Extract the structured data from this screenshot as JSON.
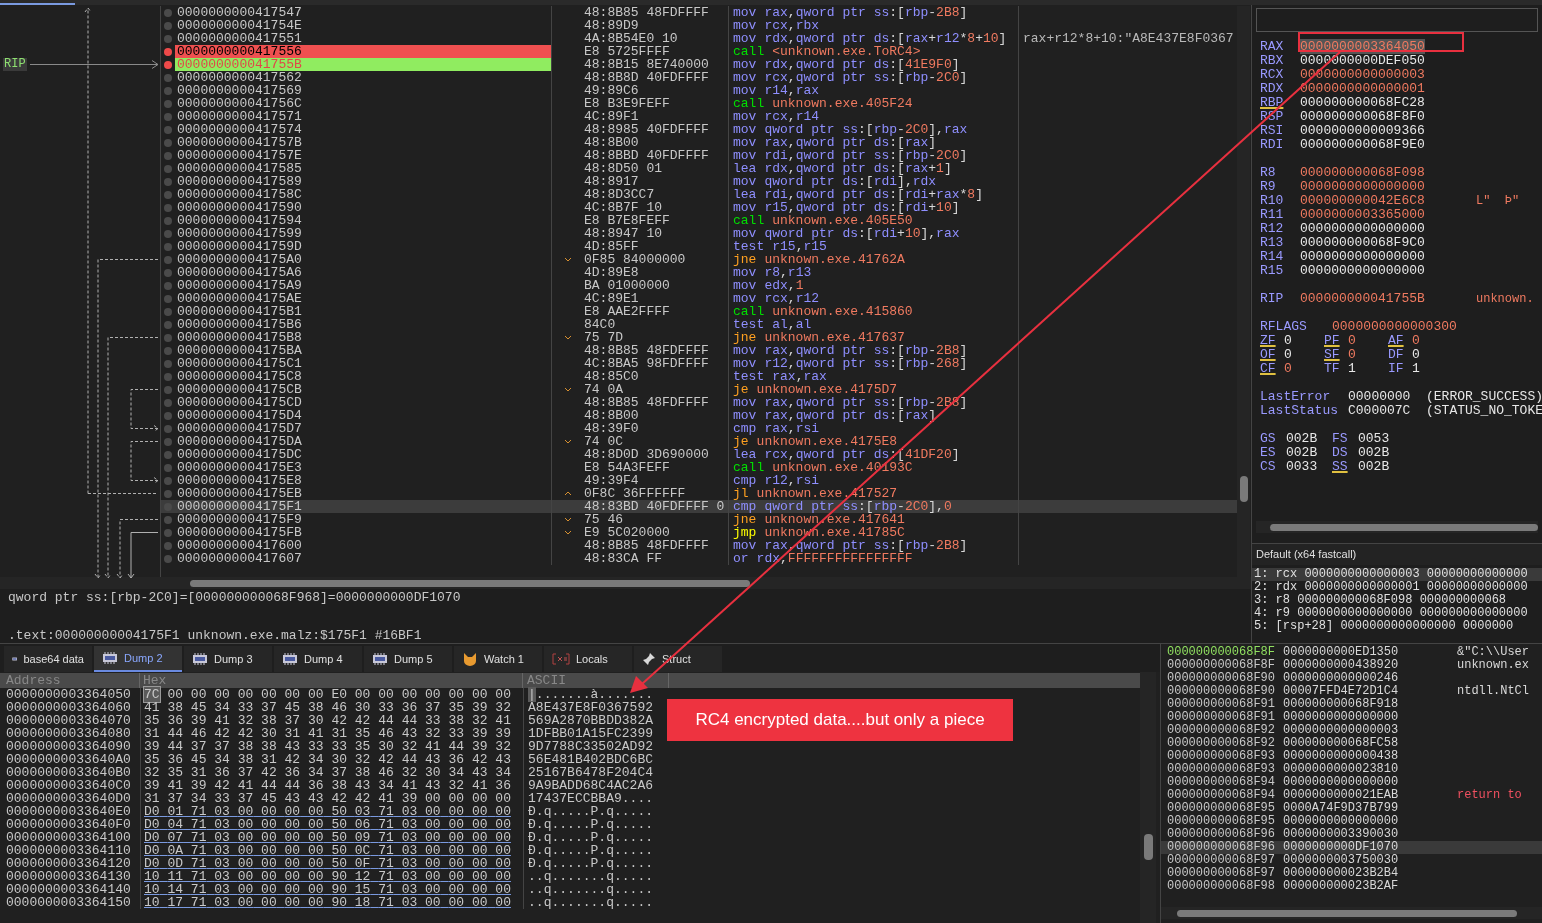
{
  "disassembly": {
    "rip_label": "RIP",
    "rows": [
      {
        "address": "0000000000417547",
        "bytes": "48:8B85 48FDFFFF",
        "mnemonic": "mov",
        "operands": "rax,qword ptr ss:[rbp-2B8]",
        "kind": "plain",
        "breakpoint": false,
        "current": false,
        "selected": false
      },
      {
        "address": "000000000041754E",
        "bytes": "48:89D9",
        "mnemonic": "mov",
        "operands": "rcx,rbx",
        "kind": "plain",
        "breakpoint": false,
        "current": false,
        "selected": false
      },
      {
        "address": "0000000000417551",
        "bytes": "4A:8B54E0 10",
        "mnemonic": "mov",
        "operands": "rdx,qword ptr ds:[rax+r12*8+10]",
        "kind": "plain",
        "breakpoint": false,
        "current": false,
        "selected": false,
        "comment": "rax+r12*8+10:\"A8E437E8F0367"
      },
      {
        "address": "0000000000417556",
        "bytes": "E8 5725FFFF",
        "mnemonic": "call",
        "operands": "<unknown.exe.ToRC4>",
        "kind": "call",
        "breakpoint": true,
        "current": false,
        "selected": false
      },
      {
        "address": "000000000041755B",
        "bytes": "48:8B15 8E740000",
        "mnemonic": "mov",
        "operands": "rdx,qword ptr ds:[41E9F0]",
        "kind": "plain",
        "breakpoint": true,
        "current": true,
        "selected": false
      },
      {
        "address": "0000000000417562",
        "bytes": "48:8B8D 40FDFFFF",
        "mnemonic": "mov",
        "operands": "rcx,qword ptr ss:[rbp-2C0]",
        "kind": "plain",
        "breakpoint": false,
        "current": false,
        "selected": false
      },
      {
        "address": "0000000000417569",
        "bytes": "49:89C6",
        "mnemonic": "mov",
        "operands": "r14,rax",
        "kind": "plain",
        "breakpoint": false,
        "current": false,
        "selected": false
      },
      {
        "address": "000000000041756C",
        "bytes": "E8 B3E9FEFF",
        "mnemonic": "call",
        "operands": "unknown.exe.405F24",
        "kind": "call",
        "breakpoint": false,
        "current": false,
        "selected": false
      },
      {
        "address": "0000000000417571",
        "bytes": "4C:89F1",
        "mnemonic": "mov",
        "operands": "rcx,r14",
        "kind": "plain",
        "breakpoint": false,
        "current": false,
        "selected": false
      },
      {
        "address": "0000000000417574",
        "bytes": "48:8985 40FDFFFF",
        "mnemonic": "mov",
        "operands": "qword ptr ss:[rbp-2C0],rax",
        "kind": "plain",
        "breakpoint": false,
        "current": false,
        "selected": false
      },
      {
        "address": "000000000041757B",
        "bytes": "48:8B00",
        "mnemonic": "mov",
        "operands": "rax,qword ptr ds:[rax]",
        "kind": "plain",
        "breakpoint": false,
        "current": false,
        "selected": false
      },
      {
        "address": "000000000041757E",
        "bytes": "48:8BBD 40FDFFFF",
        "mnemonic": "mov",
        "operands": "rdi,qword ptr ss:[rbp-2C0]",
        "kind": "plain",
        "breakpoint": false,
        "current": false,
        "selected": false
      },
      {
        "address": "0000000000417585",
        "bytes": "48:8D50 01",
        "mnemonic": "lea",
        "operands": "rdx,qword ptr ds:[rax+1]",
        "kind": "plain",
        "breakpoint": false,
        "current": false,
        "selected": false
      },
      {
        "address": "0000000000417589",
        "bytes": "48:8917",
        "mnemonic": "mov",
        "operands": "qword ptr ds:[rdi],rdx",
        "kind": "plain",
        "breakpoint": false,
        "current": false,
        "selected": false
      },
      {
        "address": "000000000041758C",
        "bytes": "48:8D3CC7",
        "mnemonic": "lea",
        "operands": "rdi,qword ptr ds:[rdi+rax*8]",
        "kind": "plain",
        "breakpoint": false,
        "current": false,
        "selected": false
      },
      {
        "address": "0000000000417590",
        "bytes": "4C:8B7F 10",
        "mnemonic": "mov",
        "operands": "r15,qword ptr ds:[rdi+10]",
        "kind": "plain",
        "breakpoint": false,
        "current": false,
        "selected": false
      },
      {
        "address": "0000000000417594",
        "bytes": "E8 B7E8FEFF",
        "mnemonic": "call",
        "operands": "unknown.exe.405E50",
        "kind": "call",
        "breakpoint": false,
        "current": false,
        "selected": false
      },
      {
        "address": "0000000000417599",
        "bytes": "48:8947 10",
        "mnemonic": "mov",
        "operands": "qword ptr ds:[rdi+10],rax",
        "kind": "plain",
        "breakpoint": false,
        "current": false,
        "selected": false
      },
      {
        "address": "000000000041759D",
        "bytes": "4D:85FF",
        "mnemonic": "test",
        "operands": "r15,r15",
        "kind": "plain",
        "breakpoint": false,
        "current": false,
        "selected": false
      },
      {
        "address": "00000000004175A0",
        "bytes": "0F85 84000000",
        "mnemonic": "jne",
        "operands": "unknown.exe.41762A",
        "kind": "branch",
        "breakpoint": false,
        "current": false,
        "selected": false
      },
      {
        "address": "00000000004175A6",
        "bytes": "4D:89E8",
        "mnemonic": "mov",
        "operands": "r8,r13",
        "kind": "plain",
        "breakpoint": false,
        "current": false,
        "selected": false
      },
      {
        "address": "00000000004175A9",
        "bytes": "BA 01000000",
        "mnemonic": "mov",
        "operands": "edx,1",
        "kind": "plain",
        "breakpoint": false,
        "current": false,
        "selected": false
      },
      {
        "address": "00000000004175AE",
        "bytes": "4C:89E1",
        "mnemonic": "mov",
        "operands": "rcx,r12",
        "kind": "plain",
        "breakpoint": false,
        "current": false,
        "selected": false
      },
      {
        "address": "00000000004175B1",
        "bytes": "E8 AAE2FFFF",
        "mnemonic": "call",
        "operands": "unknown.exe.415860",
        "kind": "call",
        "breakpoint": false,
        "current": false,
        "selected": false
      },
      {
        "address": "00000000004175B6",
        "bytes": "84C0",
        "mnemonic": "test",
        "operands": "al,al",
        "kind": "plain",
        "breakpoint": false,
        "current": false,
        "selected": false
      },
      {
        "address": "00000000004175B8",
        "bytes": "75 7D",
        "mnemonic": "jne",
        "operands": "unknown.exe.417637",
        "kind": "branch",
        "breakpoint": false,
        "current": false,
        "selected": false
      },
      {
        "address": "00000000004175BA",
        "bytes": "48:8B85 48FDFFFF",
        "mnemonic": "mov",
        "operands": "rax,qword ptr ss:[rbp-2B8]",
        "kind": "plain",
        "breakpoint": false,
        "current": false,
        "selected": false
      },
      {
        "address": "00000000004175C1",
        "bytes": "4C:8BA5 98FDFFFF",
        "mnemonic": "mov",
        "operands": "r12,qword ptr ss:[rbp-268]",
        "kind": "plain",
        "breakpoint": false,
        "current": false,
        "selected": false
      },
      {
        "address": "00000000004175C8",
        "bytes": "48:85C0",
        "mnemonic": "test",
        "operands": "rax,rax",
        "kind": "plain",
        "breakpoint": false,
        "current": false,
        "selected": false
      },
      {
        "address": "00000000004175CB",
        "bytes": "74 0A",
        "mnemonic": "je",
        "operands": "unknown.exe.4175D7",
        "kind": "branch",
        "breakpoint": false,
        "current": false,
        "selected": false
      },
      {
        "address": "00000000004175CD",
        "bytes": "48:8B85 48FDFFFF",
        "mnemonic": "mov",
        "operands": "rax,qword ptr ss:[rbp-2B8]",
        "kind": "plain",
        "breakpoint": false,
        "current": false,
        "selected": false
      },
      {
        "address": "00000000004175D4",
        "bytes": "48:8B00",
        "mnemonic": "mov",
        "operands": "rax,qword ptr ds:[rax]",
        "kind": "plain",
        "breakpoint": false,
        "current": false,
        "selected": false
      },
      {
        "address": "00000000004175D7",
        "bytes": "48:39F0",
        "mnemonic": "cmp",
        "operands": "rax,rsi",
        "kind": "plain",
        "breakpoint": false,
        "current": false,
        "selected": false
      },
      {
        "address": "00000000004175DA",
        "bytes": "74 0C",
        "mnemonic": "je",
        "operands": "unknown.exe.4175E8",
        "kind": "branch",
        "breakpoint": false,
        "current": false,
        "selected": false
      },
      {
        "address": "00000000004175DC",
        "bytes": "48:8D0D 3D690000",
        "mnemonic": "lea",
        "operands": "rcx,qword ptr ds:[41DF20]",
        "kind": "plain",
        "breakpoint": false,
        "current": false,
        "selected": false
      },
      {
        "address": "00000000004175E3",
        "bytes": "E8 54A3FEFF",
        "mnemonic": "call",
        "operands": "unknown.exe.40193C",
        "kind": "call",
        "breakpoint": false,
        "current": false,
        "selected": false
      },
      {
        "address": "00000000004175E8",
        "bytes": "49:39F4",
        "mnemonic": "cmp",
        "operands": "r12,rsi",
        "kind": "plain",
        "breakpoint": false,
        "current": false,
        "selected": false
      },
      {
        "address": "00000000004175EB",
        "bytes": "0F8C 36FFFFFF",
        "mnemonic": "jl",
        "operands": "unknown.exe.417527",
        "kind": "branch_up",
        "breakpoint": false,
        "current": false,
        "selected": false
      },
      {
        "address": "00000000004175F1",
        "bytes": "48:83BD 40FDFFFF 0",
        "mnemonic": "cmp",
        "operands": "qword ptr ss:[rbp-2C0],0",
        "kind": "plain",
        "breakpoint": false,
        "current": false,
        "selected": true
      },
      {
        "address": "00000000004175F9",
        "bytes": "75 46",
        "mnemonic": "jne",
        "operands": "unknown.exe.417641",
        "kind": "branch",
        "breakpoint": false,
        "current": false,
        "selected": false
      },
      {
        "address": "00000000004175FB",
        "bytes": "E9 5C020000",
        "mnemonic": "jmp",
        "operands": "unknown.exe.41785C",
        "kind": "jump",
        "breakpoint": false,
        "current": false,
        "selected": false
      },
      {
        "address": "0000000000417600",
        "bytes": "48:8B85 48FDFFFF",
        "mnemonic": "mov",
        "operands": "rax,qword ptr ss:[rbp-2B8]",
        "kind": "plain",
        "breakpoint": false,
        "current": false,
        "selected": false
      },
      {
        "address": "0000000000417607",
        "bytes": "48:83CA FF",
        "mnemonic": "or",
        "operands": "rdx,FFFFFFFFFFFFFFFF",
        "kind": "plain",
        "breakpoint": false,
        "current": false,
        "selected": false
      }
    ]
  },
  "info": {
    "line_1": "qword ptr ss:[rbp-2C0]=[000000000068F968]=0000000000DF1070",
    "line_2": ".text:00000000004175F1 unknown.exe.malz:$175F1 #16BF1"
  },
  "registers": {
    "groups": [
      [
        {
          "name": "RAX",
          "value": "0000000003364050",
          "changed": true,
          "underlined": false,
          "selected": true
        },
        {
          "name": "RBX",
          "value": "0000000000DEF050",
          "changed": false,
          "underlined": false,
          "selected": false
        },
        {
          "name": "RCX",
          "value": "0000000000000003",
          "changed": true,
          "underlined": false,
          "selected": false
        },
        {
          "name": "RDX",
          "value": "0000000000000001",
          "changed": true,
          "underlined": false,
          "selected": false
        },
        {
          "name": "RBP",
          "value": "000000000068FC28",
          "changed": false,
          "underlined": true,
          "selected": false
        },
        {
          "name": "RSP",
          "value": "000000000068F8F0",
          "changed": false,
          "underlined": false,
          "selected": false
        },
        {
          "name": "RSI",
          "value": "0000000000009366",
          "changed": false,
          "underlined": false,
          "selected": false
        },
        {
          "name": "RDI",
          "value": "000000000068F9E0",
          "changed": false,
          "underlined": false,
          "selected": false
        }
      ],
      [
        {
          "name": "R8",
          "value": "000000000068F098",
          "changed": true,
          "underlined": false,
          "selected": false
        },
        {
          "name": "R9",
          "value": "0000000000000000",
          "changed": true,
          "underlined": false,
          "selected": false
        },
        {
          "name": "R10",
          "value": "000000000042E6C8",
          "changed": true,
          "underlined": false,
          "selected": false,
          "comment": "L\"  Þ\""
        },
        {
          "name": "R11",
          "value": "0000000003365000",
          "changed": true,
          "underlined": false,
          "selected": false
        },
        {
          "name": "R12",
          "value": "0000000000000000",
          "changed": false,
          "underlined": false,
          "selected": false
        },
        {
          "name": "R13",
          "value": "000000000068F9C0",
          "changed": false,
          "underlined": false,
          "selected": false
        },
        {
          "name": "R14",
          "value": "0000000000000000",
          "changed": false,
          "underlined": false,
          "selected": false
        },
        {
          "name": "R15",
          "value": "0000000000000000",
          "changed": false,
          "underlined": false,
          "selected": false
        }
      ],
      [
        {
          "name": "RIP",
          "value": "000000000041755B",
          "changed": true,
          "underlined": false,
          "selected": false,
          "comment": "unknown."
        }
      ]
    ],
    "rflags": {
      "name": "RFLAGS",
      "value": "0000000000000300",
      "changed": true
    },
    "flags": [
      [
        {
          "name": "ZF",
          "value": "0",
          "changed": false,
          "underlined": true
        },
        {
          "name": "PF",
          "value": "0",
          "changed": true,
          "underlined": true
        },
        {
          "name": "AF",
          "value": "0",
          "changed": true,
          "underlined": true
        }
      ],
      [
        {
          "name": "OF",
          "value": "0",
          "changed": false,
          "underlined": true
        },
        {
          "name": "SF",
          "value": "0",
          "changed": true,
          "underlined": true
        },
        {
          "name": "DF",
          "value": "0",
          "changed": false,
          "underlined": false
        }
      ],
      [
        {
          "name": "CF",
          "value": "0",
          "changed": true,
          "underlined": true
        },
        {
          "name": "TF",
          "value": "1",
          "changed": false,
          "underlined": false
        },
        {
          "name": "IF",
          "value": "1",
          "changed": false,
          "underlined": false
        }
      ]
    ],
    "last": [
      {
        "name": "LastError",
        "value": "00000000",
        "comment": "(ERROR_SUCCESS)"
      },
      {
        "name": "LastStatus",
        "value": "C000007C",
        "comment": "(STATUS_NO_TOKE"
      }
    ],
    "segments": [
      [
        {
          "name": "GS",
          "value": "002B",
          "underlined": false
        },
        {
          "name": "FS",
          "value": "0053",
          "underlined": false
        }
      ],
      [
        {
          "name": "ES",
          "value": "002B",
          "underlined": false
        },
        {
          "name": "DS",
          "value": "002B",
          "underlined": false
        }
      ],
      [
        {
          "name": "CS",
          "value": "0033",
          "underlined": false
        },
        {
          "name": "SS",
          "value": "002B",
          "underlined": true
        }
      ]
    ]
  },
  "call_convention": {
    "title": "Default (x64 fastcall)",
    "args": [
      {
        "text": "1: rcx 0000000000000003 00000000000000",
        "selected": true
      },
      {
        "text": "2: rdx 0000000000000001 00000000000000",
        "selected": false
      },
      {
        "text": "3: r8 000000000068F098 000000000068",
        "selected": false
      },
      {
        "text": "4: r9 0000000000000000 000000000000000",
        "selected": false
      },
      {
        "text": "5: [rsp+28] 0000000000000000 0000000",
        "selected": false
      }
    ]
  },
  "tabs": [
    {
      "label": "base64 data",
      "kind": "memory",
      "selected": false
    },
    {
      "label": "Dump 2",
      "kind": "memory",
      "selected": true
    },
    {
      "label": "Dump 3",
      "kind": "memory",
      "selected": false
    },
    {
      "label": "Dump 4",
      "kind": "memory",
      "selected": false
    },
    {
      "label": "Dump 5",
      "kind": "memory",
      "selected": false
    },
    {
      "label": "Watch 1",
      "kind": "watch",
      "selected": false
    },
    {
      "label": "Locals",
      "kind": "locals",
      "selected": false
    },
    {
      "label": "Struct",
      "kind": "struct",
      "selected": false
    }
  ],
  "dump": {
    "columns": [
      "Address",
      "Hex",
      "ASCII"
    ],
    "rows": [
      {
        "address": "0000000003364050",
        "hex": "7C 00 00 00 00 00 00 00 E0 00 00 00 00 00 00 00",
        "ascii": "|.......à.......",
        "pointer": false,
        "cursor": true
      },
      {
        "address": "0000000003364060",
        "hex": "41 38 45 34 33 37 45 38 46 30 33 36 37 35 39 32",
        "ascii": "A8E437E8F0367592",
        "pointer": false,
        "cursor": false
      },
      {
        "address": "0000000003364070",
        "hex": "35 36 39 41 32 38 37 30 42 42 44 44 33 38 32 41",
        "ascii": "569A2870BBDD382A",
        "pointer": false,
        "cursor": false
      },
      {
        "address": "0000000003364080",
        "hex": "31 44 46 42 42 30 31 41 31 35 46 43 32 33 39 39",
        "ascii": "1DFBB01A15FC2399",
        "pointer": false,
        "cursor": false
      },
      {
        "address": "0000000003364090",
        "hex": "39 44 37 37 38 38 43 33 33 35 30 32 41 44 39 32",
        "ascii": "9D7788C33502AD92",
        "pointer": false,
        "cursor": false
      },
      {
        "address": "00000000033640A0",
        "hex": "35 36 45 34 38 31 42 34 30 32 42 44 43 36 42 43",
        "ascii": "56E481B402BDC6BC",
        "pointer": false,
        "cursor": false
      },
      {
        "address": "00000000033640B0",
        "hex": "32 35 31 36 37 42 36 34 37 38 46 32 30 34 43 34",
        "ascii": "25167B6478F204C4",
        "pointer": false,
        "cursor": false
      },
      {
        "address": "00000000033640C0",
        "hex": "39 41 39 42 41 44 44 36 38 43 34 41 43 32 41 36",
        "ascii": "9A9BADD68C4AC2A6",
        "pointer": false,
        "cursor": false
      },
      {
        "address": "00000000033640D0",
        "hex": "31 37 34 33 37 45 43 43 42 42 41 39 00 00 00 00",
        "ascii": "17437ECCBBA9....",
        "pointer": false,
        "cursor": false
      },
      {
        "address": "00000000033640E0",
        "hex": "D0 01 71 03 00 00 00 00 50 03 71 03 00 00 00 00",
        "ascii": "Ð.q.....P.q.....",
        "pointer": true,
        "cursor": false
      },
      {
        "address": "00000000033640F0",
        "hex": "D0 04 71 03 00 00 00 00 50 06 71 03 00 00 00 00",
        "ascii": "Ð.q.....P.q.....",
        "pointer": true,
        "cursor": false
      },
      {
        "address": "0000000003364100",
        "hex": "D0 07 71 03 00 00 00 00 50 09 71 03 00 00 00 00",
        "ascii": "Ð.q.....P.q.....",
        "pointer": true,
        "cursor": false
      },
      {
        "address": "0000000003364110",
        "hex": "D0 0A 71 03 00 00 00 00 50 0C 71 03 00 00 00 00",
        "ascii": "Ð.q.....P.q.....",
        "pointer": true,
        "cursor": false
      },
      {
        "address": "0000000003364120",
        "hex": "D0 0D 71 03 00 00 00 00 50 0F 71 03 00 00 00 00",
        "ascii": "Ð.q.....P.q.....",
        "pointer": true,
        "cursor": false
      },
      {
        "address": "0000000003364130",
        "hex": "10 11 71 03 00 00 00 00 90 12 71 03 00 00 00 00",
        "ascii": "..q.......q.....",
        "pointer": true,
        "cursor": false
      },
      {
        "address": "0000000003364140",
        "hex": "10 14 71 03 00 00 00 00 90 15 71 03 00 00 00 00",
        "ascii": "..q.......q.....",
        "pointer": true,
        "cursor": false
      },
      {
        "address": "0000000003364150",
        "hex": "10 17 71 03 00 00 00 00 90 18 71 03 00 00 00 00",
        "ascii": "..q.......q.....",
        "pointer": true,
        "cursor": false
      }
    ]
  },
  "stack": {
    "rows": [
      {
        "address": "000000000068F8F",
        "value": "0000000000ED1350",
        "comment": "&\"C:\\\\User",
        "return_address": false,
        "rsp": true,
        "selected": false
      },
      {
        "address": "000000000068F8F",
        "value": "0000000000438920",
        "comment": "unknown.ex",
        "return_address": false,
        "rsp": false,
        "selected": false
      },
      {
        "address": "000000000068F90",
        "value": "0000000000000246",
        "rsp": false,
        "selected": false
      },
      {
        "address": "000000000068F90",
        "value": "00007FFD4E72D1C4",
        "comment": "ntdll.NtCl",
        "return_address": false,
        "rsp": false,
        "selected": false
      },
      {
        "address": "000000000068F91",
        "value": "000000000068F918",
        "rsp": false,
        "selected": false
      },
      {
        "address": "000000000068F91",
        "value": "0000000000000000",
        "rsp": false,
        "selected": false
      },
      {
        "address": "000000000068F92",
        "value": "0000000000000003",
        "rsp": false,
        "selected": false
      },
      {
        "address": "000000000068F92",
        "value": "000000000068FC58",
        "rsp": false,
        "selected": false
      },
      {
        "address": "000000000068F93",
        "value": "0000000000000438",
        "rsp": false,
        "selected": false
      },
      {
        "address": "000000000068F93",
        "value": "0000000000023810",
        "rsp": false,
        "selected": false
      },
      {
        "address": "000000000068F94",
        "value": "0000000000000000",
        "rsp": false,
        "selected": false
      },
      {
        "address": "000000000068F94",
        "value": "0000000000021EAB",
        "comment": "return to",
        "return_address": true,
        "rsp": false,
        "selected": false
      },
      {
        "address": "000000000068F95",
        "value": "0000A74F9D37B799",
        "rsp": false,
        "selected": false
      },
      {
        "address": "000000000068F95",
        "value": "0000000000000000",
        "rsp": false,
        "selected": false
      },
      {
        "address": "000000000068F96",
        "value": "0000000003390030",
        "rsp": false,
        "selected": false
      },
      {
        "address": "000000000068F96",
        "value": "0000000000DF1070",
        "rsp": false,
        "selected": true
      },
      {
        "address": "000000000068F97",
        "value": "0000000003750030",
        "rsp": false,
        "selected": false
      },
      {
        "address": "000000000068F97",
        "value": "000000000023B2B4",
        "rsp": false,
        "selected": false
      },
      {
        "address": "000000000068F98",
        "value": "000000000023B2AF",
        "rsp": false,
        "selected": false
      }
    ]
  },
  "annotation": {
    "text": "RC4 encrypted data....but only a piece"
  }
}
